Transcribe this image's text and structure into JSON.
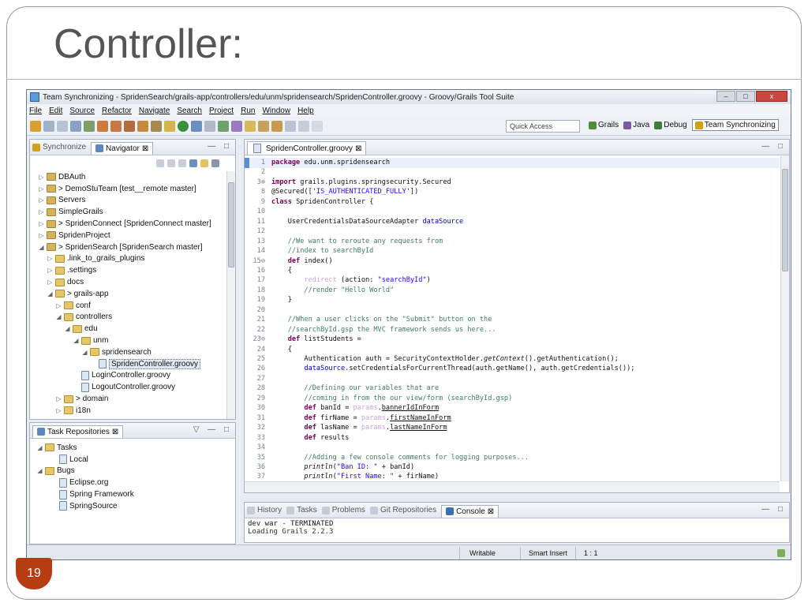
{
  "slide": {
    "title": "Controller:",
    "number": "19"
  },
  "window": {
    "title": "Team Synchronizing - SpridenSearch/grails-app/controllers/edu/unm/spridensearch/SpridenController.groovy - Groovy/Grails Tool Suite",
    "controls": {
      "minimize": "–",
      "maximize": "□",
      "close": "x"
    }
  },
  "menu": [
    "File",
    "Edit",
    "Source",
    "Refactor",
    "Navigate",
    "Search",
    "Project",
    "Run",
    "Window",
    "Help"
  ],
  "toolbar": {
    "quick_access_placeholder": "Quick Access",
    "perspectives": [
      {
        "label": "Grails",
        "color": "#4f8f3a"
      },
      {
        "label": "Java",
        "color": "#7a5aa8"
      },
      {
        "label": "Debug",
        "color": "#3f7d3f"
      },
      {
        "label": "Team Synchronizing",
        "color": "#d4a017"
      }
    ]
  },
  "navigator": {
    "tabs": [
      {
        "label": "Synchronize",
        "close": ""
      },
      {
        "label": "Navigator",
        "close": "⊠"
      }
    ],
    "controls": "— □",
    "tree": [
      {
        "label": "DBAuth",
        "depth": 0,
        "icon": "proj",
        "arrow": "▷"
      },
      {
        "label": "> DemoStuTeam  [test__remote master]",
        "depth": 0,
        "icon": "proj",
        "arrow": "▷"
      },
      {
        "label": "Servers",
        "depth": 0,
        "icon": "proj",
        "arrow": "▷"
      },
      {
        "label": "SimpleGrails",
        "depth": 0,
        "icon": "proj",
        "arrow": "▷"
      },
      {
        "label": "> SpridenConnect  [SpridenConnect master]",
        "depth": 0,
        "icon": "proj",
        "arrow": "▷"
      },
      {
        "label": "SpridenProject",
        "depth": 0,
        "icon": "proj",
        "arrow": "▷"
      },
      {
        "label": "> SpridenSearch  [SpridenSearch master]",
        "depth": 0,
        "icon": "proj",
        "arrow": "◢"
      },
      {
        "label": ".link_to_grails_plugins",
        "depth": 1,
        "icon": "folder",
        "arrow": "▷"
      },
      {
        "label": ".settings",
        "depth": 1,
        "icon": "folder",
        "arrow": "▷"
      },
      {
        "label": "docs",
        "depth": 1,
        "icon": "folder",
        "arrow": "▷"
      },
      {
        "label": "> grails-app",
        "depth": 1,
        "icon": "folder",
        "arrow": "◢"
      },
      {
        "label": "conf",
        "depth": 2,
        "icon": "folder",
        "arrow": "▷"
      },
      {
        "label": "controllers",
        "depth": 2,
        "icon": "folder",
        "arrow": "◢"
      },
      {
        "label": "edu",
        "depth": 3,
        "icon": "folder",
        "arrow": "◢"
      },
      {
        "label": "unm",
        "depth": 4,
        "icon": "folder",
        "arrow": "◢"
      },
      {
        "label": "spridensearch",
        "depth": 5,
        "icon": "folder",
        "arrow": "◢"
      },
      {
        "label": "SpridenController.groovy",
        "depth": 6,
        "icon": "file",
        "arrow": "",
        "selected": true
      },
      {
        "label": "LoginController.groovy",
        "depth": 4,
        "icon": "file",
        "arrow": ""
      },
      {
        "label": "LogoutController.groovy",
        "depth": 4,
        "icon": "file",
        "arrow": ""
      },
      {
        "label": "> domain",
        "depth": 2,
        "icon": "folder",
        "arrow": "▷"
      },
      {
        "label": "i18n",
        "depth": 2,
        "icon": "folder",
        "arrow": "▷"
      }
    ]
  },
  "tasks": {
    "tab_label": "Task Repositories",
    "tab_close": "⊠",
    "controls": "▽ — □",
    "tree": [
      {
        "label": "Tasks",
        "depth": 0,
        "icon": "folder",
        "arrow": "◢"
      },
      {
        "label": "Local",
        "depth": 1,
        "icon": "file",
        "arrow": ""
      },
      {
        "label": "Bugs",
        "depth": 0,
        "icon": "folder",
        "arrow": "◢"
      },
      {
        "label": "Eclipse.org",
        "depth": 1,
        "icon": "file",
        "arrow": ""
      },
      {
        "label": "Spring Framework",
        "depth": 1,
        "icon": "file",
        "arrow": ""
      },
      {
        "label": "SpringSource",
        "depth": 1,
        "icon": "file",
        "arrow": ""
      }
    ]
  },
  "editor": {
    "tab_label": "SpridenController.groovy",
    "tab_close": "⊠",
    "controls": "— □",
    "lines": [
      {
        "n": "1",
        "current": true,
        "parts": [
          [
            "kw",
            "package"
          ],
          [
            "",
            "edu.unm.spridensearch"
          ]
        ]
      },
      {
        "n": "2",
        "parts": []
      },
      {
        "n": "3⊕",
        "parts": [
          [
            "kw",
            "import"
          ],
          [
            "",
            "grails.plugins.springsecurity.Secured"
          ]
        ]
      },
      {
        "n": "8",
        "parts": [
          [
            "",
            "@Secured(['"
          ],
          [
            "st",
            "IS_AUTHENTICATED_FULLY"
          ],
          [
            "",
            "'])"
          ]
        ]
      },
      {
        "n": "9",
        "parts": [
          [
            "kw",
            "class"
          ],
          [
            "",
            "SpridenController {"
          ]
        ]
      },
      {
        "n": "10",
        "parts": []
      },
      {
        "n": "11",
        "parts": [
          [
            "",
            "    UserCredentialsDataSourceAdapter "
          ],
          [
            "fd",
            "dataSource"
          ]
        ]
      },
      {
        "n": "12",
        "parts": []
      },
      {
        "n": "13",
        "parts": [
          [
            "cm",
            "    //We want to reroute any requests from"
          ]
        ]
      },
      {
        "n": "14",
        "parts": [
          [
            "cm",
            "    //index to searchById"
          ]
        ]
      },
      {
        "n": "15⊖",
        "parts": [
          [
            "kw",
            "    def"
          ],
          [
            "",
            "index()"
          ]
        ]
      },
      {
        "n": "16",
        "parts": [
          [
            "",
            "    {"
          ]
        ]
      },
      {
        "n": "17",
        "parts": [
          [
            "dim",
            "        redirect"
          ],
          [
            "",
            " (action: "
          ],
          [
            "st",
            "\"searchById\""
          ],
          [
            "",
            ")"
          ]
        ]
      },
      {
        "n": "18",
        "parts": [
          [
            "cm",
            "        //render \"Hello World\""
          ]
        ]
      },
      {
        "n": "19",
        "parts": [
          [
            "",
            "    }"
          ]
        ]
      },
      {
        "n": "20",
        "parts": []
      },
      {
        "n": "21",
        "parts": [
          [
            "cm",
            "    //When a user clicks on the \"Submit\" button on the"
          ]
        ]
      },
      {
        "n": "22",
        "parts": [
          [
            "cm",
            "    //searchById.gsp the MVC framework sends us here..."
          ]
        ]
      },
      {
        "n": "23⊖",
        "parts": [
          [
            "kw",
            "    def"
          ],
          [
            "",
            "listStudents ="
          ]
        ]
      },
      {
        "n": "24",
        "parts": [
          [
            "",
            "    {"
          ]
        ]
      },
      {
        "n": "25",
        "parts": [
          [
            "",
            "        Authentication auth = SecurityContextHolder."
          ],
          [
            "it",
            "getContext"
          ],
          [
            "",
            "().getAuthentication();"
          ]
        ]
      },
      {
        "n": "26",
        "parts": [
          [
            "fd",
            "        dataSource"
          ],
          [
            "",
            ".setCredentialsForCurrentThread(auth.getName(), auth.getCredentials());"
          ]
        ]
      },
      {
        "n": "27",
        "parts": []
      },
      {
        "n": "28",
        "parts": [
          [
            "cm",
            "        //Defining our variables that are"
          ]
        ]
      },
      {
        "n": "29",
        "parts": [
          [
            "cm",
            "        //coming in from the our view/form (searchById.gsp)"
          ]
        ]
      },
      {
        "n": "30",
        "parts": [
          [
            "kw",
            "        def"
          ],
          [
            "",
            "banId = "
          ],
          [
            "dim",
            "params"
          ],
          [
            "",
            "."
          ],
          [
            "ul",
            "bannerIdInForm"
          ]
        ]
      },
      {
        "n": "31",
        "parts": [
          [
            "kw",
            "        def"
          ],
          [
            "",
            "firName = "
          ],
          [
            "dim",
            "params"
          ],
          [
            "",
            "."
          ],
          [
            "ul",
            "firstNameInForm"
          ]
        ]
      },
      {
        "n": "32",
        "parts": [
          [
            "kw",
            "        def"
          ],
          [
            "",
            "lasName = "
          ],
          [
            "dim",
            "params"
          ],
          [
            "",
            "."
          ],
          [
            "ul",
            "lastNameInForm"
          ]
        ]
      },
      {
        "n": "33",
        "parts": [
          [
            "kw",
            "        def"
          ],
          [
            "",
            "results"
          ]
        ]
      },
      {
        "n": "34",
        "parts": []
      },
      {
        "n": "35",
        "parts": [
          [
            "cm",
            "        //Adding a few console comments for logging purposes..."
          ]
        ]
      },
      {
        "n": "36",
        "parts": [
          [
            "it",
            "        println"
          ],
          [
            "",
            "("
          ],
          [
            "st",
            "\"Ban ID: \""
          ],
          [
            "",
            " + banId)"
          ]
        ]
      },
      {
        "n": "37",
        "parts": [
          [
            "it",
            "        println"
          ],
          [
            "",
            "("
          ],
          [
            "st",
            "\"First Name: \""
          ],
          [
            "",
            " + firName)"
          ]
        ]
      }
    ]
  },
  "console": {
    "tabs": [
      {
        "label": "History"
      },
      {
        "label": "Tasks"
      },
      {
        "label": "Problems"
      },
      {
        "label": "Git Repositories"
      },
      {
        "label": "Console",
        "active": true,
        "close": "⊠"
      }
    ],
    "controls": "— □",
    "line1": "dev war - TERMINATED",
    "line2": "Loading Grails 2.2.3"
  },
  "status": {
    "writable": "Writable",
    "insert_mode": "Smart Insert",
    "position": "1 : 1"
  },
  "colors": {
    "accent": "#b83c12",
    "editor_current_line": "#e8f0fb"
  }
}
